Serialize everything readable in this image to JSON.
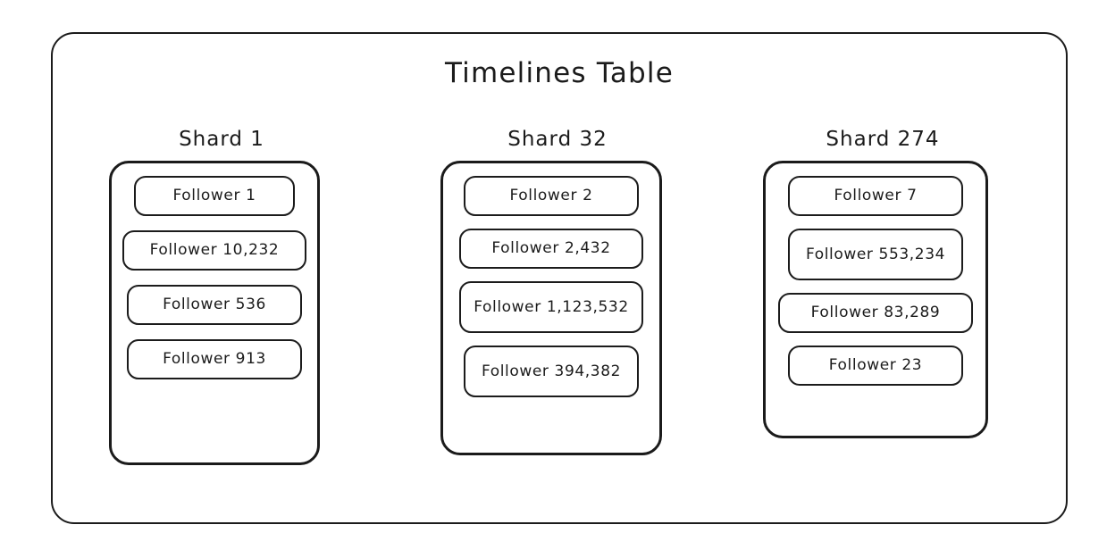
{
  "diagram": {
    "title": "Timelines Table",
    "background_color": "#ffffff",
    "stroke_color": "#1b1b1b",
    "text_color": "#1b1b1b",
    "style": "hand-drawn"
  },
  "shards": [
    {
      "label": "Shard 1",
      "items": [
        {
          "label": "Follower 1"
        },
        {
          "label": "Follower 10,232"
        },
        {
          "label": "Follower 536"
        },
        {
          "label": "Follower 913"
        }
      ]
    },
    {
      "label": "Shard 32",
      "items": [
        {
          "label": "Follower 2"
        },
        {
          "label": "Follower 2,432"
        },
        {
          "label": "Follower 1,123,532"
        },
        {
          "label": "Follower 394,382"
        }
      ]
    },
    {
      "label": "Shard 274",
      "items": [
        {
          "label": "Follower 7"
        },
        {
          "label": "Follower 553,234"
        },
        {
          "label": "Follower 83,289"
        },
        {
          "label": "Follower 23"
        }
      ]
    }
  ]
}
